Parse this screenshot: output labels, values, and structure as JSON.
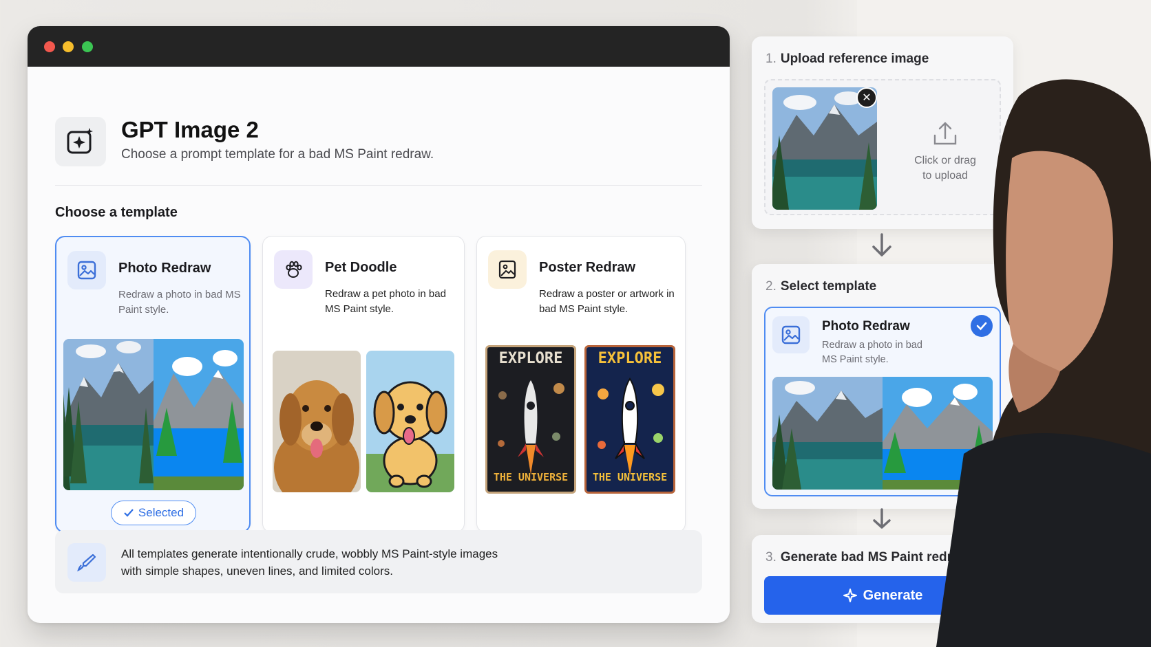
{
  "app": {
    "title": "GPT Image 2",
    "subtitle": "Choose a prompt template for a bad MS Paint redraw."
  },
  "templates": {
    "section_label": "Choose a template",
    "cards": [
      {
        "title": "Photo Redraw",
        "desc": "Redraw a photo in bad MS Paint style.",
        "icon": "image-icon"
      },
      {
        "title": "Pet Doodle",
        "desc": "Redraw a pet photo in bad MS Paint style.",
        "icon": "paw-icon"
      },
      {
        "title": "Poster Redraw",
        "desc": "Redraw a poster or artwork in bad MS Paint style.",
        "icon": "image-icon"
      }
    ],
    "selected_label": "Selected",
    "poster_top_text": "EXPLORE",
    "poster_bottom_text": "THE UNIVERSE"
  },
  "info": {
    "line1": "All templates generate intentionally crude, wobbly MS Paint-style images",
    "line2": "with simple shapes, uneven lines, and limited colors."
  },
  "steps": {
    "step1": {
      "num": "1.",
      "title": "Upload reference image",
      "hint_line1": "Click or drag",
      "hint_line2": "to upload"
    },
    "step2": {
      "num": "2.",
      "title": "Select template",
      "card_title": "Photo Redraw",
      "card_desc": "Redraw a photo in bad MS Paint style."
    },
    "step3": {
      "num": "3.",
      "title": "Generate bad MS Paint redraw",
      "button": "Generate"
    }
  },
  "colors": {
    "accent": "#2563eb",
    "selected_border": "#4f8cf2",
    "titlebar": "#242424"
  }
}
